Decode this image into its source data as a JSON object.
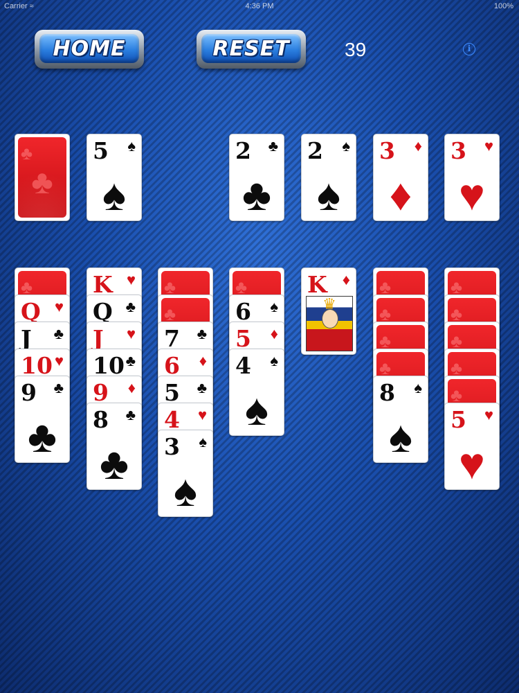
{
  "status_bar": {
    "carrier": "Carrier ≈",
    "time": "4:36 PM",
    "battery": "100%"
  },
  "toolbar": {
    "home_label": "HOME",
    "reset_label": "RESET",
    "score": "39",
    "info_symbol": "i"
  },
  "colors": {
    "red_suit": "#d6131a",
    "black_suit": "#0c0c0c",
    "felt": "#1a4fae",
    "button": "#2b7fe0"
  },
  "stock": {
    "face_down": true
  },
  "waste": {
    "rank": "5",
    "suit": "♠",
    "color": "black"
  },
  "foundations": [
    {
      "rank": "2",
      "suit": "♣",
      "color": "black"
    },
    {
      "rank": "2",
      "suit": "♠",
      "color": "black"
    },
    {
      "rank": "3",
      "suit": "♦",
      "color": "red"
    },
    {
      "rank": "3",
      "suit": "♥",
      "color": "red"
    }
  ],
  "tableau": [
    [
      {
        "down": true
      },
      {
        "rank": "Q",
        "suit": "♥",
        "color": "red"
      },
      {
        "rank": "J",
        "suit": "♣",
        "color": "black"
      },
      {
        "rank": "10",
        "suit": "♥",
        "color": "red"
      },
      {
        "rank": "9",
        "suit": "♣",
        "color": "black"
      }
    ],
    [
      {
        "rank": "K",
        "suit": "♥",
        "color": "red"
      },
      {
        "rank": "Q",
        "suit": "♣",
        "color": "black"
      },
      {
        "rank": "J",
        "suit": "♥",
        "color": "red"
      },
      {
        "rank": "10",
        "suit": "♣",
        "color": "black"
      },
      {
        "rank": "9",
        "suit": "♦",
        "color": "red"
      },
      {
        "rank": "8",
        "suit": "♣",
        "color": "black"
      }
    ],
    [
      {
        "down": true
      },
      {
        "down": true
      },
      {
        "rank": "7",
        "suit": "♣",
        "color": "black"
      },
      {
        "rank": "6",
        "suit": "♦",
        "color": "red"
      },
      {
        "rank": "5",
        "suit": "♣",
        "color": "black"
      },
      {
        "rank": "4",
        "suit": "♥",
        "color": "red"
      },
      {
        "rank": "3",
        "suit": "♠",
        "color": "black"
      }
    ],
    [
      {
        "down": true
      },
      {
        "rank": "6",
        "suit": "♠",
        "color": "black"
      },
      {
        "rank": "5",
        "suit": "♦",
        "color": "red"
      },
      {
        "rank": "4",
        "suit": "♠",
        "color": "black"
      }
    ],
    [
      {
        "rank": "K",
        "suit": "♦",
        "color": "red",
        "royal": true
      }
    ],
    [
      {
        "down": true
      },
      {
        "down": true
      },
      {
        "down": true
      },
      {
        "down": true
      },
      {
        "rank": "8",
        "suit": "♠",
        "color": "black"
      }
    ],
    [
      {
        "down": true
      },
      {
        "down": true
      },
      {
        "down": true
      },
      {
        "down": true
      },
      {
        "down": true
      },
      {
        "rank": "5",
        "suit": "♥",
        "color": "red"
      }
    ]
  ]
}
